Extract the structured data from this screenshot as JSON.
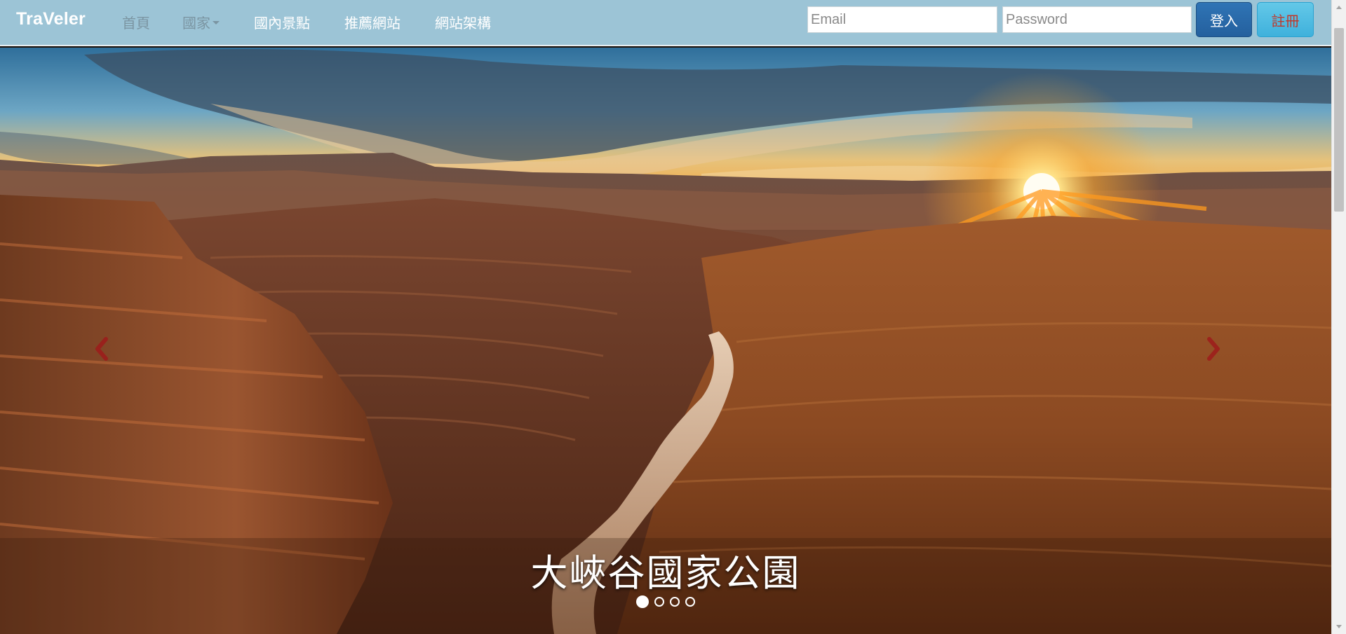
{
  "navbar": {
    "brand": "TraVeler",
    "items": [
      {
        "label": "首頁"
      },
      {
        "label": "國家"
      },
      {
        "label": "國內景點"
      },
      {
        "label": "推薦網站"
      },
      {
        "label": "網站架構"
      }
    ],
    "email_placeholder": "Email",
    "password_placeholder": "Password",
    "login_label": "登入",
    "register_label": "註冊"
  },
  "carousel": {
    "caption": "大峽谷國家公園",
    "slide_count": 4,
    "active_index": 0
  },
  "colors": {
    "navbar_bg": "#9cc4d6",
    "login_button": "#2f74b5",
    "register_button": "#4fbde3",
    "register_text": "#c0392b",
    "carousel_arrow": "#9e1b1b"
  },
  "icons": {
    "prev": "chevron-left-icon",
    "next": "chevron-right-icon",
    "dropdown": "caret-down-icon"
  }
}
